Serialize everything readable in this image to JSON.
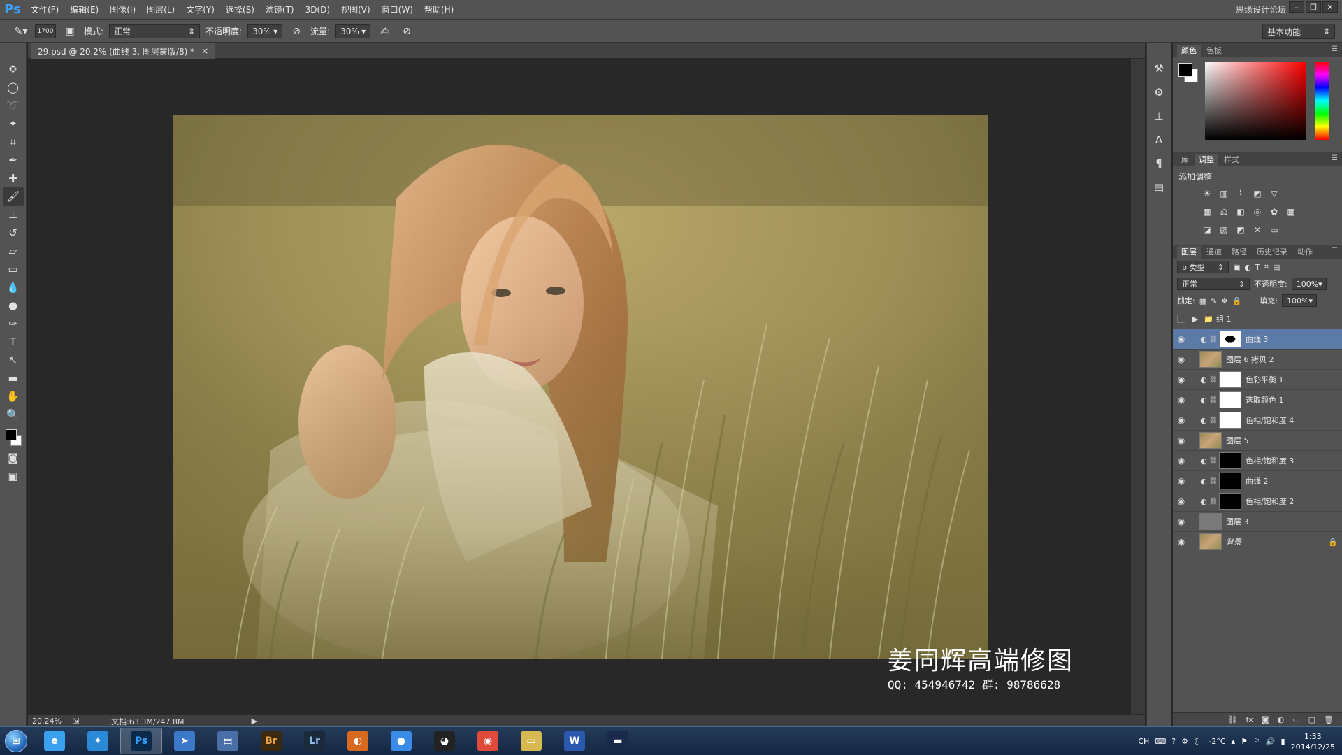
{
  "app": {
    "logo": "Ps",
    "window_title": "思缘设计论坛"
  },
  "menu": [
    "文件(F)",
    "编辑(E)",
    "图像(I)",
    "图层(L)",
    "文字(Y)",
    "选择(S)",
    "滤镜(T)",
    "3D(D)",
    "视图(V)",
    "窗口(W)",
    "帮助(H)"
  ],
  "options_bar": {
    "brush_size": "1700",
    "mode_label": "模式:",
    "mode_value": "正常",
    "opacity_label": "不透明度:",
    "opacity_value": "30%",
    "flow_label": "流量:",
    "flow_value": "30%",
    "workspace": "基本功能"
  },
  "document": {
    "tab_title": "29.psd @ 20.2% (曲线 3, 图层蒙版/8) *",
    "close": "×",
    "zoom": "20.24%",
    "doc_size": "文档:63.3M/247.8M"
  },
  "watermark": {
    "title": "姜同辉高端修图",
    "contact": "QQ: 454946742  群: 98786628"
  },
  "color_panel": {
    "tabs": [
      "颜色",
      "色板"
    ]
  },
  "adjust_panel": {
    "tabs": [
      "库",
      "调整",
      "样式"
    ],
    "title": "添加调整"
  },
  "layers_panel": {
    "tabs": [
      "图层",
      "通道",
      "路径",
      "历史记录",
      "动作"
    ],
    "filter": "ρ 类型",
    "blend_mode": "正常",
    "opacity_label": "不透明度:",
    "opacity_value": "100%",
    "lock_label": "锁定:",
    "fill_label": "填充:",
    "fill_value": "100%",
    "group_name": "组 1",
    "layers": [
      {
        "name": "曲线 3",
        "thumb": "oval",
        "type": "adjustment",
        "selected": true
      },
      {
        "name": "图层 6 拷贝 2",
        "thumb": "photo",
        "type": "pixel",
        "selected": false
      },
      {
        "name": "色彩平衡 1",
        "thumb": "white",
        "type": "adjustment",
        "selected": false
      },
      {
        "name": "选取颜色 1",
        "thumb": "white",
        "type": "adjustment",
        "selected": false
      },
      {
        "name": "色相/饱和度 4",
        "thumb": "white",
        "type": "adjustment",
        "selected": false
      },
      {
        "name": "图层 5",
        "thumb": "photo",
        "type": "pixel",
        "selected": false
      },
      {
        "name": "色相/饱和度 3",
        "thumb": "black",
        "type": "adjustment",
        "selected": false
      },
      {
        "name": "曲线 2",
        "thumb": "black",
        "type": "adjustment",
        "selected": false
      },
      {
        "name": "色相/饱和度 2",
        "thumb": "black",
        "type": "adjustment",
        "selected": false
      },
      {
        "name": "图层 3",
        "thumb": "gray",
        "type": "pixel",
        "selected": false
      },
      {
        "name": "背景",
        "thumb": "photo",
        "type": "background",
        "selected": false
      }
    ]
  },
  "taskbar": {
    "apps": [
      {
        "id": "ie",
        "label": "e",
        "color": "#3aa0f0"
      },
      {
        "id": "app2",
        "label": "✦",
        "color": "#2a8ad8"
      },
      {
        "id": "photoshop",
        "label": "Ps",
        "color": "#0b2a4a"
      },
      {
        "id": "app4",
        "label": "➤",
        "color": "#3b78c8"
      },
      {
        "id": "app5",
        "label": "▤",
        "color": "#4a6ea8"
      },
      {
        "id": "bridge",
        "label": "Br",
        "color": "#3a2a10"
      },
      {
        "id": "lightroom",
        "label": "Lr",
        "color": "#1a2a3a"
      },
      {
        "id": "app8",
        "label": "◐",
        "color": "#d86a20"
      },
      {
        "id": "app9",
        "label": "●",
        "color": "#3a8ae8"
      },
      {
        "id": "qq",
        "label": "◕",
        "color": "#222"
      },
      {
        "id": "chrome",
        "label": "◉",
        "color": "#e04a3a"
      },
      {
        "id": "explorer",
        "label": "▭",
        "color": "#d8b850"
      },
      {
        "id": "word",
        "label": "W",
        "color": "#2a5ab0"
      },
      {
        "id": "app14",
        "label": "▬",
        "color": "#1a2a4a"
      }
    ],
    "tray": {
      "lang": "CH",
      "temp": "-2°C",
      "time": "1:33",
      "date": "2014/12/25"
    }
  }
}
